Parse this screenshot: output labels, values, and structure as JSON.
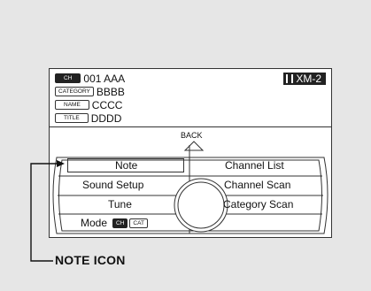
{
  "info": {
    "ch_tag": "CH",
    "ch_value": "001 AAA",
    "category_tag": "CATEGORY",
    "category_value": "BBBB",
    "name_tag": "NAME",
    "name_value": "CCCC",
    "title_tag": "TITLE",
    "title_value": "DDDD",
    "band": "XM-2"
  },
  "back_label": "BACK",
  "menu": {
    "left": [
      "Note",
      "Sound Setup",
      "Tune"
    ],
    "mode_label": "Mode",
    "mode_tags": [
      "CH",
      "CAT"
    ],
    "right": [
      "Channel List",
      "Channel Scan",
      "Category Scan"
    ]
  },
  "callout_label": "NOTE ICON",
  "colors": {
    "background": "#e6e6e6",
    "screen": "#ffffff",
    "line": "#333333"
  }
}
